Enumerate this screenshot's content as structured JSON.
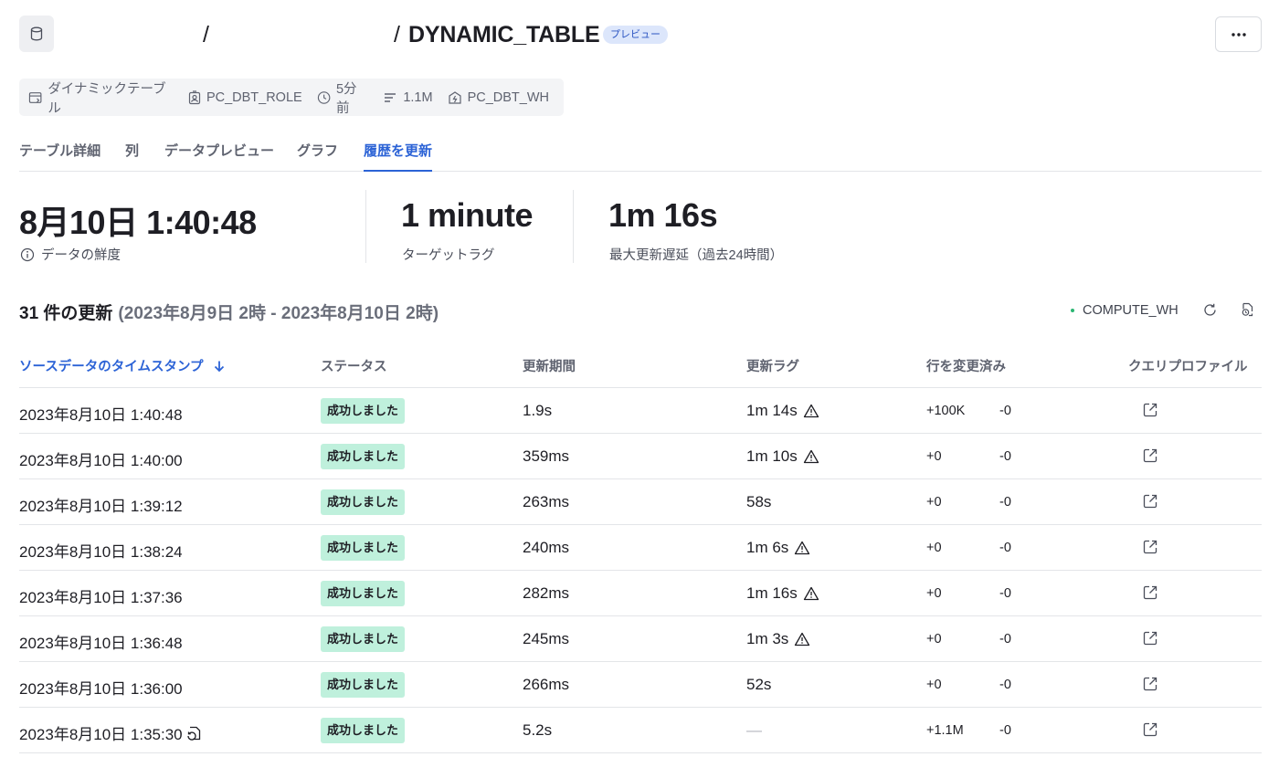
{
  "header": {
    "breadcrumb_separator_1": "/",
    "breadcrumb_separator_2": "/",
    "title": "DYNAMIC_TABLE",
    "preview_badge": "プレビュー"
  },
  "meta": {
    "type": "ダイナミックテーブル",
    "role": "PC_DBT_ROLE",
    "time": "5分前",
    "rows": "1.1M",
    "warehouse": "PC_DBT_WH"
  },
  "tabs": [
    {
      "label": "テーブル詳細"
    },
    {
      "label": "列"
    },
    {
      "label": "データプレビュー"
    },
    {
      "label": "グラフ"
    },
    {
      "label": "履歴を更新",
      "active": true
    }
  ],
  "stats": {
    "freshness_value": "8月10日 1:40:48",
    "freshness_label": "データの鮮度",
    "target_lag_value": "1 minute",
    "target_lag_label": "ターゲットラグ",
    "max_delay_value": "1m 16s",
    "max_delay_label": "最大更新遅延（過去24時間）"
  },
  "refresh_summary": {
    "count": "31 件の更新",
    "range": "(2023年8月9日 2時 - 2023年8月10日 2時)",
    "warehouse": "COMPUTE_WH"
  },
  "table": {
    "columns": [
      "ソースデータのタイムスタンプ",
      "ステータス",
      "更新期間",
      "更新ラグ",
      "行を変更済み",
      "クエリプロファイル"
    ],
    "rows": [
      {
        "timestamp": "2023年8月10日 1:40:48",
        "status": "成功しました",
        "duration": "1.9s",
        "lag": "1m 14s",
        "warning": true,
        "added": "+100K",
        "removed": "-0"
      },
      {
        "timestamp": "2023年8月10日 1:40:00",
        "status": "成功しました",
        "duration": "359ms",
        "lag": "1m 10s",
        "warning": true,
        "added": "+0",
        "removed": "-0"
      },
      {
        "timestamp": "2023年8月10日 1:39:12",
        "status": "成功しました",
        "duration": "263ms",
        "lag": "58s",
        "warning": false,
        "added": "+0",
        "removed": "-0"
      },
      {
        "timestamp": "2023年8月10日 1:38:24",
        "status": "成功しました",
        "duration": "240ms",
        "lag": "1m 6s",
        "warning": true,
        "added": "+0",
        "removed": "-0"
      },
      {
        "timestamp": "2023年8月10日 1:37:36",
        "status": "成功しました",
        "duration": "282ms",
        "lag": "1m 16s",
        "warning": true,
        "added": "+0",
        "removed": "-0"
      },
      {
        "timestamp": "2023年8月10日 1:36:48",
        "status": "成功しました",
        "duration": "245ms",
        "lag": "1m 3s",
        "warning": true,
        "added": "+0",
        "removed": "-0"
      },
      {
        "timestamp": "2023年8月10日 1:36:00",
        "status": "成功しました",
        "duration": "266ms",
        "lag": "52s",
        "warning": false,
        "added": "+0",
        "removed": "-0"
      },
      {
        "timestamp": "2023年8月10日 1:35:30",
        "status": "成功しました",
        "duration": "5.2s",
        "lag": "—",
        "warning": false,
        "added": "+1.1M",
        "removed": "-0",
        "initial": true
      }
    ]
  },
  "colors": {
    "accent": "#2c63d6",
    "success_bg": "#bff0dc",
    "status_dot": "#2bb673",
    "badge_bg": "#dce6fb"
  }
}
